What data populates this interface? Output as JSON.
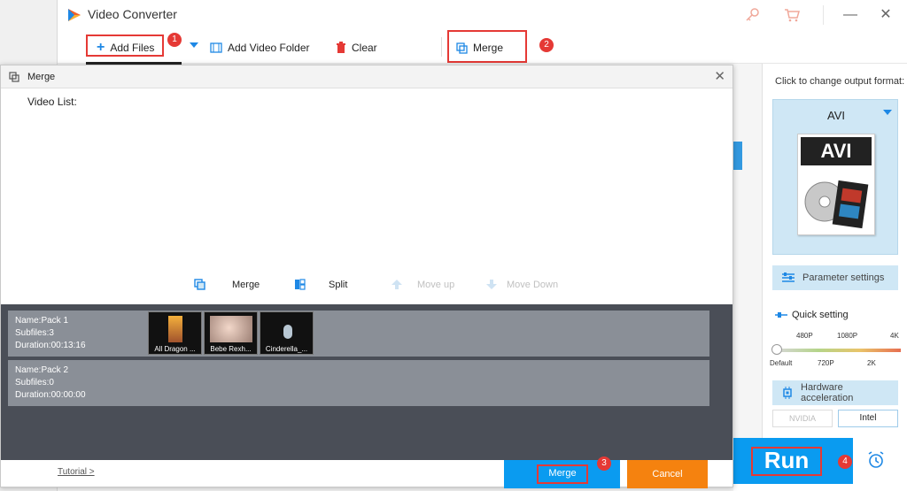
{
  "app": {
    "title": "Video Converter",
    "logo_icon": "video-converter-logo",
    "key_icon": "key-icon",
    "cart_icon": "cart-icon",
    "minimize": "—",
    "close": "✕"
  },
  "toolbar": {
    "add_files": "Add Files",
    "add_video_folder": "Add Video Folder",
    "clear": "Clear",
    "merge": "Merge"
  },
  "steps": [
    "1",
    "2",
    "3",
    "4"
  ],
  "right_panel": {
    "output_label": "Click to change output format:",
    "format": "AVI",
    "format_box_label": "AVI",
    "parameter_settings": "Parameter settings",
    "quick_setting": "Quick setting",
    "quality_top": [
      "480P",
      "1080P",
      "4K"
    ],
    "quality_bottom": [
      "Default",
      "720P",
      "2K"
    ],
    "quality_level": 0,
    "hardware_acceleration": "Hardware acceleration",
    "nvidia": "NVIDIA",
    "intel": "Intel"
  },
  "run": {
    "label": "Run",
    "alarm_icon": "alarm-clock-icon"
  },
  "dialog": {
    "title": "Merge",
    "close": "✕",
    "video_list_label": "Video List:",
    "tools": {
      "merge": "Merge",
      "split": "Split",
      "move_up": "Move up",
      "move_down": "Move Down"
    },
    "packs": [
      {
        "name": "Name:Pack 1",
        "subfiles": "Subfiles:3",
        "duration": "Duration:00:13:16",
        "thumbs": [
          "All Dragon ...",
          "Bebe Rexh...",
          "Cinderella_..."
        ]
      },
      {
        "name": "Name:Pack 2",
        "subfiles": "Subfiles:0",
        "duration": "Duration:00:00:00",
        "thumbs": []
      }
    ],
    "tutorial": "Tutorial >",
    "merge_button": "Merge",
    "cancel_button": "Cancel"
  },
  "colors": {
    "accent_blue": "#0a9bf0",
    "cancel_orange": "#f5820f",
    "highlight_red": "#e53935",
    "format_card_bg": "#cfe7f5"
  }
}
